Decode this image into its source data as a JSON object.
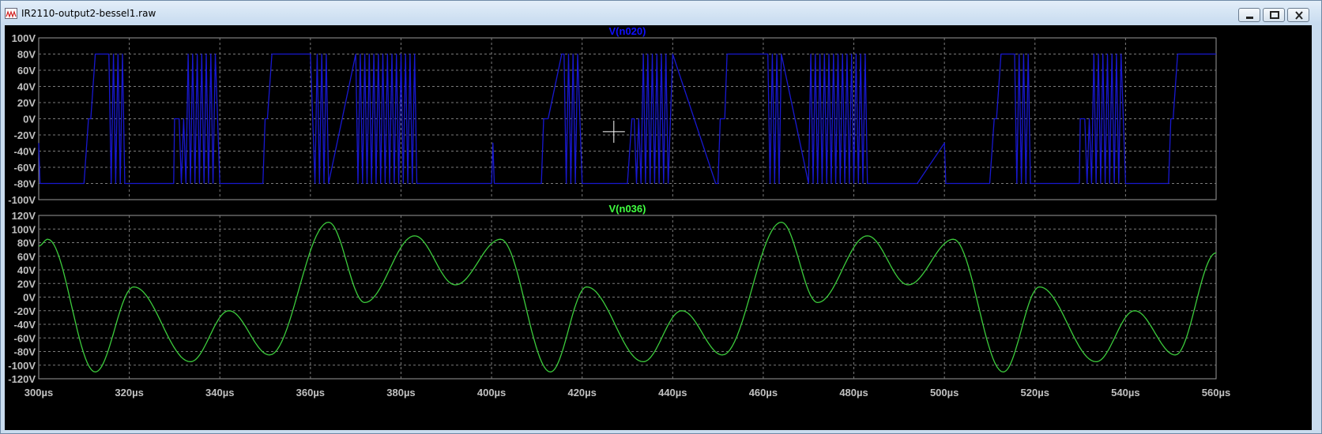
{
  "window": {
    "title": "IR2110-output2-bessel1.raw",
    "icon": "waveform-viewer-icon"
  },
  "chart_data": [
    {
      "type": "line",
      "title": "V(n020)",
      "title_color": "#1010ff",
      "series_color": "#1818d0",
      "background": "#000000",
      "grid": true,
      "x_unit": "µs",
      "xlim": [
        300,
        560
      ],
      "ylim": [
        -100,
        100
      ],
      "y_ticks": [
        "100V",
        "80V",
        "60V",
        "40V",
        "20V",
        "0V",
        "-20V",
        "-40V",
        "-60V",
        "-80V",
        "-100V"
      ],
      "y_tick_values": [
        100,
        80,
        60,
        40,
        20,
        0,
        -20,
        -40,
        -60,
        -80,
        -100
      ],
      "levels": [
        80,
        -80
      ],
      "x": [
        300,
        300.3,
        300.6,
        310,
        311,
        311.5,
        312.5,
        315.5,
        316,
        316.5,
        317,
        317.5,
        318,
        318.5,
        319,
        320,
        329.8,
        330,
        331,
        331.5,
        332,
        332.5,
        333,
        333.5,
        334,
        334.5,
        335,
        335.5,
        336,
        336.5,
        337,
        337.5,
        338,
        338.5,
        339,
        340,
        349.5,
        350,
        350.5,
        351.5,
        352,
        360,
        361,
        361.5,
        362,
        362.5,
        363,
        363.5,
        364,
        370,
        370.5,
        371,
        371.5,
        372,
        372.5,
        373,
        373.5,
        374,
        374.5,
        375,
        375.5,
        376,
        376.5,
        377,
        377.5,
        378,
        378.5,
        379,
        379.5,
        380,
        380.5,
        381,
        381.5,
        382,
        382.5,
        383,
        383.5,
        384,
        390,
        390.5,
        391,
        391.5,
        392,
        392.5,
        393,
        393.5,
        394,
        400,
        400.3,
        400.6,
        410,
        411,
        411.5,
        412.5,
        415.5,
        416,
        416.5,
        417,
        417.5,
        418,
        418.5,
        419,
        420,
        429.8,
        430,
        431,
        431.5,
        432,
        432.5,
        433,
        433.5,
        434,
        434.5,
        435,
        435.5,
        436,
        436.5,
        437,
        437.5,
        438,
        438.5,
        439,
        440,
        449.5,
        450,
        450.5,
        451.5,
        452,
        460,
        461,
        461.5,
        462,
        462.5,
        463,
        463.5,
        464,
        470,
        470.5,
        471,
        471.5,
        472,
        472.5,
        473,
        473.5,
        474,
        474.5,
        475,
        475.5,
        476,
        476.5,
        477,
        477.5,
        478,
        478.5,
        479,
        479.5,
        480,
        480.5,
        481,
        481.5,
        482,
        482.5,
        483,
        483.5,
        484,
        490,
        490.5,
        491,
        491.5,
        492,
        492.5,
        493,
        493.5,
        494,
        500,
        500.3,
        500.6,
        510,
        511,
        511.5,
        512.5,
        515.5,
        516,
        516.5,
        517,
        517.5,
        518,
        518.5,
        519,
        520,
        529.8,
        530,
        531,
        531.5,
        532,
        532.5,
        533,
        533.5,
        534,
        534.5,
        535,
        535.5,
        536,
        536.5,
        537,
        537.5,
        538,
        538.5,
        539,
        540,
        549.5,
        550,
        550.5,
        551.5,
        552,
        560
      ],
      "y": [
        -30,
        -80,
        -80,
        -80,
        0,
        0,
        80,
        80,
        -80,
        80,
        -80,
        80,
        -80,
        80,
        -80,
        -80,
        -80,
        0,
        0,
        -80,
        0,
        -80,
        80,
        -80,
        80,
        -80,
        80,
        -80,
        80,
        -80,
        80,
        -80,
        80,
        -80,
        80,
        -80,
        -80,
        0,
        0,
        80,
        80,
        80,
        -80,
        80,
        -80,
        80,
        -80,
        80,
        -80,
        80,
        -80,
        80,
        -80,
        80,
        -80,
        80,
        -80,
        80,
        -80,
        80,
        -80,
        80,
        -80,
        80,
        -80,
        80,
        -80,
        80,
        -80,
        80,
        -80,
        80,
        -80,
        80,
        -80,
        80,
        -80,
        -80,
        -80,
        -80,
        -80,
        -80,
        -80,
        -80,
        -80,
        -80,
        -80,
        -80,
        -30,
        -80,
        -80,
        -80,
        0,
        0,
        80,
        80,
        -80,
        80,
        -80,
        80,
        -80,
        80,
        -80,
        -80,
        -80,
        0,
        0,
        -80,
        0,
        -80,
        80,
        -80,
        80,
        -80,
        80,
        -80,
        80,
        -80,
        80,
        -80,
        80,
        -80,
        80,
        -80,
        -80,
        0,
        0,
        80,
        80,
        80,
        -80,
        80,
        -80,
        80,
        -80,
        80,
        -80,
        80,
        -80,
        80,
        -80,
        80,
        -80,
        80,
        -80,
        80,
        -80,
        80,
        -80,
        80,
        -80,
        80,
        -80,
        80,
        -80,
        80,
        -80,
        80,
        -80,
        80,
        -80,
        80,
        -80,
        -80,
        -80,
        -80,
        -80,
        -80,
        -80,
        -80,
        -80,
        -80,
        -80,
        -80,
        -30,
        -80,
        -80,
        -80,
        0,
        0,
        80,
        80,
        -80,
        80,
        -80,
        80,
        -80,
        80,
        -80,
        -80,
        -80,
        0,
        0,
        -80,
        0,
        -80,
        80,
        -80,
        80,
        -80,
        80,
        -80,
        80,
        -80,
        80,
        -80,
        80,
        -80,
        80,
        -80,
        -80,
        0,
        0,
        80,
        80,
        80
      ]
    },
    {
      "type": "line",
      "title": "V(n036)",
      "title_color": "#40ff40",
      "series_color": "#3ccc3c",
      "background": "#000000",
      "grid": true,
      "x_unit": "µs",
      "xlim": [
        300,
        560
      ],
      "ylim": [
        -120,
        120
      ],
      "y_ticks": [
        "120V",
        "100V",
        "80V",
        "60V",
        "40V",
        "20V",
        "0V",
        "-20V",
        "-40V",
        "-60V",
        "-80V",
        "-100V",
        "-120V"
      ],
      "y_tick_values": [
        120,
        100,
        80,
        60,
        40,
        20,
        0,
        -20,
        -40,
        -60,
        -80,
        -100,
        -120
      ],
      "x_ticks": [
        "300µs",
        "320µs",
        "340µs",
        "360µs",
        "380µs",
        "400µs",
        "420µs",
        "440µs",
        "460µs",
        "480µs",
        "500µs",
        "520µs",
        "540µs",
        "560µs"
      ],
      "x_tick_values": [
        300,
        320,
        340,
        360,
        380,
        400,
        420,
        440,
        460,
        480,
        500,
        520,
        540,
        560
      ],
      "x": [
        300,
        302,
        312.5,
        321,
        333.5,
        342,
        351,
        364,
        372,
        383,
        392,
        402,
        413,
        421,
        433.5,
        442,
        451,
        464,
        472,
        483,
        492,
        502,
        513,
        521,
        533.5,
        542,
        551,
        560
      ],
      "y": [
        75,
        85,
        -110,
        15,
        -95,
        -20,
        -85,
        110,
        -8,
        90,
        18,
        85,
        -110,
        15,
        -95,
        -20,
        -85,
        110,
        -8,
        90,
        18,
        85,
        -110,
        15,
        -95,
        -20,
        -85,
        65
      ]
    }
  ],
  "cursor": {
    "x_us": 427,
    "y_v": -16
  }
}
